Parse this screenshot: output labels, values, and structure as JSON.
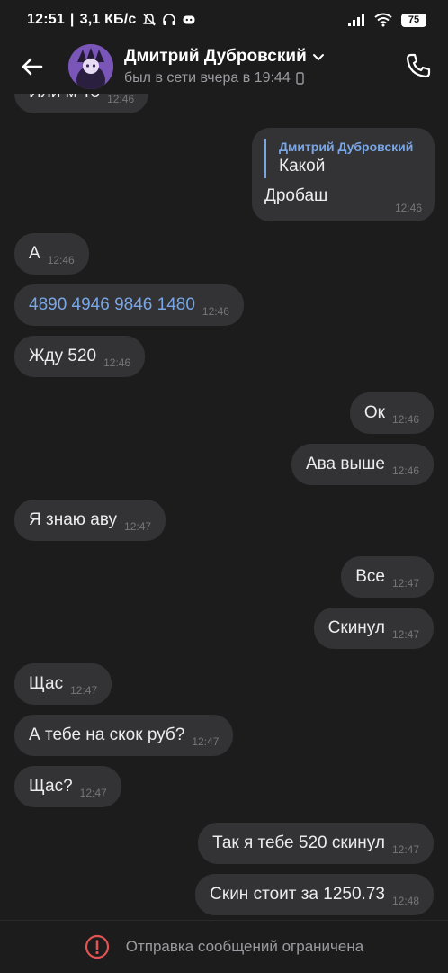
{
  "status": {
    "time": "12:51",
    "speed": "3,1 КБ/с",
    "battery": "75"
  },
  "header": {
    "name": "Дмитрий Дубровский",
    "last_seen": "был в сети вчера в 19:44"
  },
  "messages": {
    "m0": {
      "text": "Или м-то",
      "time": "12:46"
    },
    "reply": {
      "quote_author": "Дмитрий Дубровский",
      "quote_text": "Какой",
      "text": "Дробаш",
      "time": "12:46"
    },
    "m1": {
      "text": "А",
      "time": "12:46"
    },
    "m2": {
      "text": "4890 4946 9846 1480",
      "time": "12:46"
    },
    "m3": {
      "text": "Жду 520",
      "time": "12:46"
    },
    "m4": {
      "text": "Ок",
      "time": "12:46"
    },
    "m5": {
      "text": "Ава выше",
      "time": "12:46"
    },
    "m6": {
      "text": "Я знаю аву",
      "time": "12:47"
    },
    "m7": {
      "text": "Все",
      "time": "12:47"
    },
    "m8": {
      "text": "Скинул",
      "time": "12:47"
    },
    "m9": {
      "text": "Щас",
      "time": "12:47"
    },
    "m10": {
      "text": "А тебе на скок руб?",
      "time": "12:47"
    },
    "m11": {
      "text": "Щас?",
      "time": "12:47"
    },
    "m12": {
      "text": "Так я тебе 520 скинул",
      "time": "12:47"
    },
    "m13": {
      "text": "Скин стоит за 1250.73",
      "time": "12:48"
    }
  },
  "footer": {
    "restriction_text": "Отправка сообщений ограничена"
  },
  "colors": {
    "background": "#1c1c1d",
    "bubble": "#333336",
    "link": "#79a6e4",
    "warning": "#e05454"
  },
  "icons": [
    "back-arrow-icon",
    "phone-icon",
    "mute-bell-icon",
    "headphones-icon",
    "discord-icon",
    "signal-icon",
    "wifi-icon",
    "battery-icon",
    "phone-small-icon",
    "chevron-down-icon",
    "warning-icon"
  ]
}
